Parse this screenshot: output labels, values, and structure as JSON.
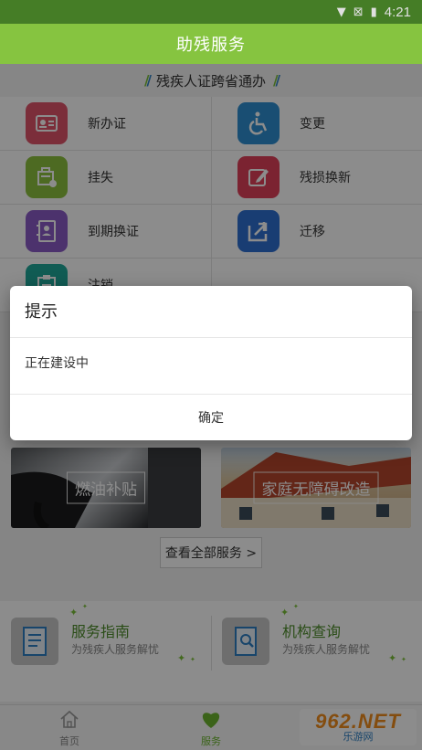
{
  "status_bar": {
    "time": "4:21",
    "icons": [
      "wifi-icon",
      "no-sim-icon",
      "battery-charging-icon"
    ]
  },
  "header": {
    "title": "助残服务"
  },
  "section": {
    "title": "残疾人证跨省通办"
  },
  "services": [
    {
      "label": "新办证",
      "icon": "id-card-icon",
      "color": "#e0556b"
    },
    {
      "label": "变更",
      "icon": "wheelchair-icon",
      "color": "#2e8fd1"
    },
    {
      "label": "挂失",
      "icon": "report-loss-icon",
      "color": "#8cc13f"
    },
    {
      "label": "残损换新",
      "icon": "edit-icon",
      "color": "#e0415a"
    },
    {
      "label": "到期换证",
      "icon": "contacts-book-icon",
      "color": "#8b5cc7"
    },
    {
      "label": "迁移",
      "icon": "share-icon",
      "color": "#2e6fd1"
    },
    {
      "label": "注销",
      "icon": "clipboard-icon",
      "color": "#1fa89a"
    }
  ],
  "banners": [
    {
      "label": "燃油补贴"
    },
    {
      "label": "家庭无障碍改造"
    }
  ],
  "view_all": {
    "label": "查看全部服务 >"
  },
  "guides": [
    {
      "title": "服务指南",
      "subtitle": "为残疾人服务解忧",
      "icon": "document-icon"
    },
    {
      "title": "机构查询",
      "subtitle": "为残疾人服务解忧",
      "icon": "search-book-icon"
    }
  ],
  "bottom_nav": [
    {
      "label": "首页",
      "icon": "home-icon",
      "active": false
    },
    {
      "label": "服务",
      "icon": "heart-icon",
      "active": true
    }
  ],
  "watermark": {
    "logo_text": "962.NET",
    "subtitle": "乐游网"
  },
  "dialog": {
    "title": "提示",
    "message": "正在建设中",
    "confirm_label": "确定"
  },
  "colors": {
    "accent": "#86c440",
    "active_nav": "#6cb52f"
  }
}
